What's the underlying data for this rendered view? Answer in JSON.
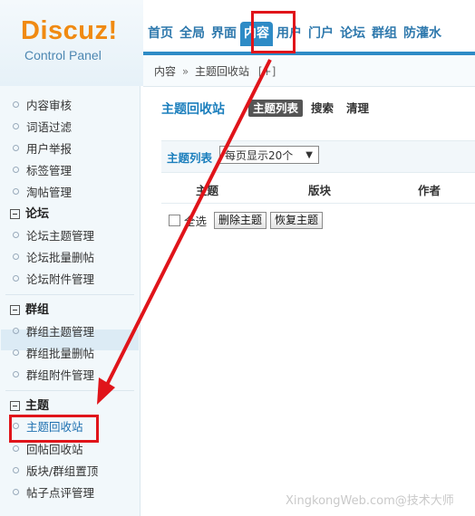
{
  "logo": {
    "brand": "Discuz!",
    "subtitle": "Control Panel"
  },
  "top_nav": {
    "items": [
      "首页",
      "全局",
      "界面",
      "内容",
      "用户",
      "门户",
      "论坛",
      "群组",
      "防灌水"
    ],
    "active": "内容"
  },
  "breadcrumb": {
    "parts": [
      "内容",
      "主题回收站"
    ],
    "separator": "»",
    "add": "[+]"
  },
  "sidebar": {
    "items_top": [
      "内容审核",
      "词语过滤",
      "用户举报",
      "标签管理",
      "淘帖管理"
    ],
    "groups": [
      {
        "title": "论坛",
        "items": [
          "论坛主题管理",
          "论坛批量删帖",
          "论坛附件管理"
        ]
      },
      {
        "title": "群组",
        "items": [
          "群组主题管理",
          "群组批量删帖",
          "群组附件管理"
        ]
      },
      {
        "title": "主题",
        "items": [
          "主题回收站",
          "回帖回收站",
          "版块/群组置顶",
          "帖子点评管理"
        ]
      }
    ],
    "active_item": "主题回收站"
  },
  "main": {
    "title": "主题回收站",
    "tabs": [
      {
        "label": "主题列表",
        "current": true
      },
      {
        "label": "搜索",
        "current": false
      },
      {
        "label": "清理",
        "current": false
      }
    ],
    "filter": {
      "label": "主题列表",
      "per_page": "每页显示20个"
    },
    "table_headers": [
      "主题",
      "版块",
      "作者"
    ],
    "actions": {
      "select_all": "全选",
      "delete": "删除主题",
      "restore": "恢复主题"
    }
  },
  "watermark": "XingkongWeb.com@技术大师",
  "colors": {
    "accent": "#2e8bc6",
    "link": "#1c7fbd",
    "logo": "#f08a12",
    "annotation": "#e0141a"
  }
}
